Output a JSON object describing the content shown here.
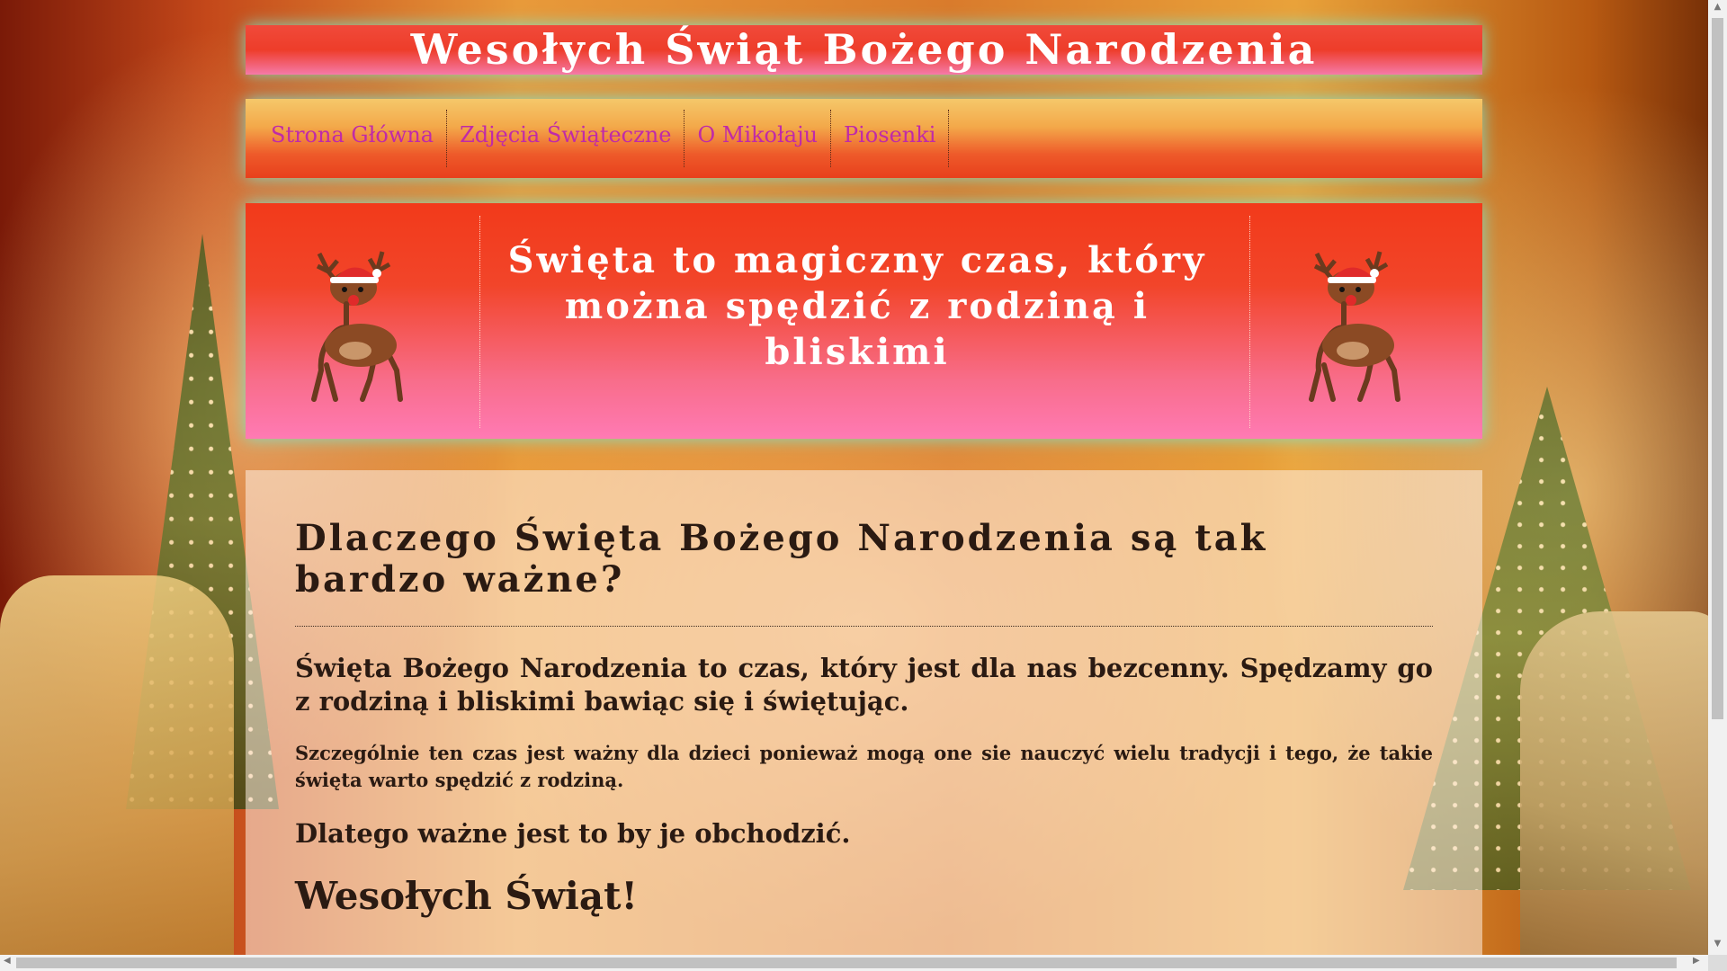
{
  "header": {
    "title": "Wesołych Świąt Bożego Narodzenia"
  },
  "nav": {
    "items": [
      {
        "label": "Strona Główna"
      },
      {
        "label": "Zdjęcia Świąteczne"
      },
      {
        "label": "O Mikołaju"
      },
      {
        "label": "Piosenki"
      }
    ]
  },
  "hero": {
    "text": "Święta to magiczny czas, który można spędzić z rodziną i bliskimi",
    "left_image": "reindeer-icon",
    "right_image": "reindeer-icon"
  },
  "content": {
    "heading": "Dlaczego Święta Bożego Narodzenia są tak bardzo ważne?",
    "paragraph1": "Święta Bożego Narodzenia to czas, który jest dla nas bezcenny. Spędzamy go z rodziną i bliskimi bawiąc się i świętując.",
    "paragraph2": "Szczególnie ten czas jest ważny dla dzieci ponieważ mogą one sie nauczyć wielu tradycji i tego, że takie święta warto spędzić z rodziną.",
    "paragraph3": "Dlatego ważne jest to by je obchodzić.",
    "wish": "Wesołych Świąt!"
  },
  "colors": {
    "nav_link": "#c02aa8",
    "title_bg": "#ee3d2a",
    "hero_bottom": "#ff7ab4",
    "glow": "#78e6d2"
  }
}
